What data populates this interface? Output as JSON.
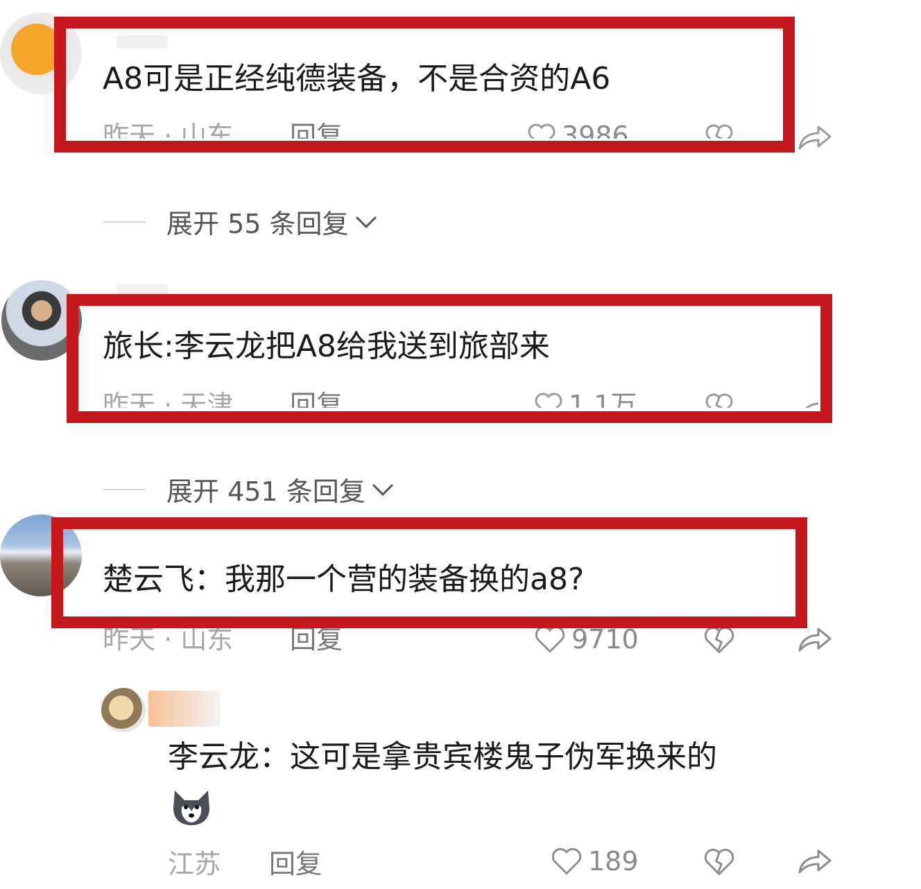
{
  "comments": [
    {
      "text": "A8可是正经纯德装备，不是合资的A6",
      "meta": "昨天 · 山东",
      "reply_label": "回复",
      "likes": "3986",
      "expand": "展开 55 条回复"
    },
    {
      "text": "旅长:李云龙把A8给我送到旅部来",
      "meta": "昨天 · 天津",
      "reply_label": "回复",
      "likes": "1.1万",
      "expand": "展开 451 条回复"
    },
    {
      "text": "楚云飞：我那一个营的装备换的a8?",
      "meta": "昨天 · 山东",
      "reply_label": "回复",
      "likes": "9710"
    }
  ],
  "sub_reply": {
    "text": "李云龙：这可是拿贵宾楼鬼子伪军换来的",
    "meta": "江苏",
    "reply_label": "回复",
    "likes": "189"
  },
  "colors": {
    "highlight_border": "#c4161b",
    "meta_text": "#a6a6a6"
  }
}
